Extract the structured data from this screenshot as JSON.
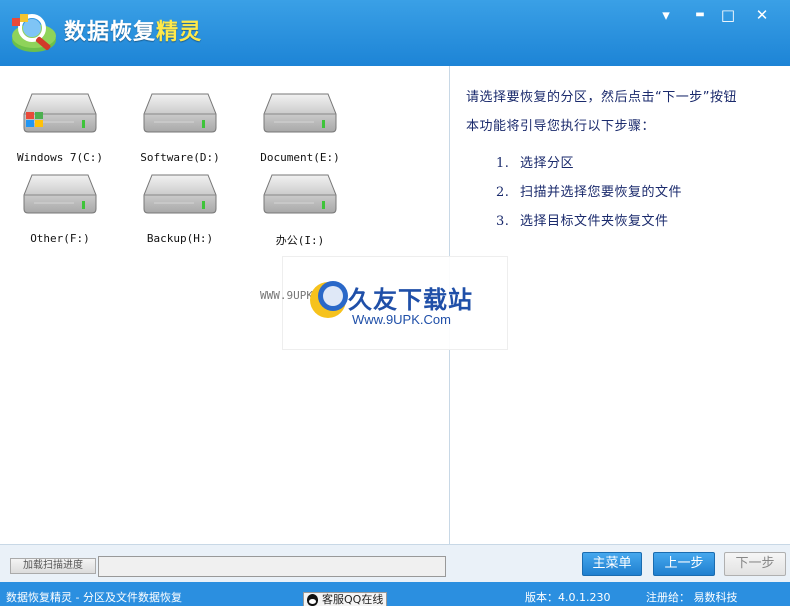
{
  "app": {
    "title_part1": "数据恢复",
    "title_part2": "精灵"
  },
  "window_controls": {
    "menu_icon": "▾",
    "minimize_icon": "▬",
    "maximize_icon": "□",
    "close_icon": "✕"
  },
  "drives": [
    {
      "label": "Windows 7(C:)",
      "icon": "system-drive-icon"
    },
    {
      "label": "Software(D:)",
      "icon": "drive-icon"
    },
    {
      "label": "Document(E:)",
      "icon": "drive-icon"
    },
    {
      "label": "Other(F:)",
      "icon": "drive-icon"
    },
    {
      "label": "Backup(H:)",
      "icon": "drive-icon"
    },
    {
      "label": "办公(I:)",
      "icon": "drive-icon"
    }
  ],
  "instructions": {
    "line1": "请选择要恢复的分区，然后点击“下一步”按钮",
    "line2": "本功能将引导您执行以下步骤：",
    "steps": [
      {
        "num": "1.",
        "text": "选择分区"
      },
      {
        "num": "2.",
        "text": "扫描并选择您要恢复的文件"
      },
      {
        "num": "3.",
        "text": "选择目标文件夹恢复文件"
      }
    ]
  },
  "watermark": {
    "small": "WWW.9UPK.COM",
    "title": "久友下载站",
    "url": "Www.9UPK.Com"
  },
  "bottom": {
    "load_progress_label": "加载扫描进度",
    "main_menu_label": "主菜单",
    "prev_label": "上一步",
    "next_label": "下一步"
  },
  "status": {
    "left": "数据恢复精灵 - 分区及文件数据恢复",
    "qq": "客服QQ在线",
    "version": "版本：4.0.1.230",
    "registered": "注册给：  易数科技"
  },
  "colors": {
    "title_bar": "#1d84d6",
    "accent_blue": "#2b8fe0",
    "title_highlight": "#ffe94a"
  }
}
